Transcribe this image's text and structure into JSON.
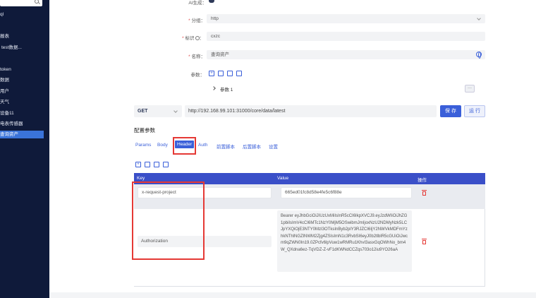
{
  "sidebar": {
    "items": [
      {
        "label": "ql"
      },
      {
        "label": "报表"
      },
      {
        "label": "test数据..."
      },
      {
        "label": "token"
      },
      {
        "label": "数据"
      },
      {
        "label": "用户"
      },
      {
        "label": "天气"
      },
      {
        "label": "设备11"
      },
      {
        "label": "电表传感器"
      },
      {
        "label": "查询资产"
      }
    ]
  },
  "form": {
    "ai_label": "AI生成：",
    "group_label": "分组：",
    "group_value": "http",
    "id_label": "标识",
    "id_value": "cxzc",
    "name_label": "名称：",
    "name_value": "查询资产",
    "params_label": "参数：",
    "param_row_label": "参数 1",
    "more_label": "···"
  },
  "request": {
    "method": "GET",
    "url": "http://192.168.99.101:31000/core/data/latest",
    "save_label": "保 存",
    "run_label": "运 行"
  },
  "config": {
    "title": "配置参数",
    "tabs": [
      {
        "label": "Params"
      },
      {
        "label": "Body"
      },
      {
        "label": "Header"
      },
      {
        "label": "Auth"
      },
      {
        "label": "前置脚本"
      },
      {
        "label": "后置脚本"
      },
      {
        "label": "设置"
      }
    ]
  },
  "table": {
    "headers": {
      "key": "Key",
      "value": "Value",
      "action": "操作"
    },
    "rows": [
      {
        "key": "x-request-project",
        "value": "665ed01fc8d58e4fe5c6f88e"
      },
      {
        "key": "Authorization",
        "value": "Bearer eyJhbGciOiJIUzUxMiIsInR5cCI6IkpXVCJ9.eyJzdWIiOiJhZG1pbiIsImV4cCI6MTc1NzY0MjM5OSwibmJmIjoxNzU2NDMyNzk5LCJpYXQiOjE3NTY0MzI3OTksInByb2plY3RJZCI6IjY2NWVkMDFmYzhkNThlNGZlNWM2Zjg4ZSIsImN1c3RvbSI6eyJ0b2tlblR5cGUiOiJwcm9qZWN0In19.0ZPcfv6lpVuw1wRMRu1KhvI3asxGqOWhNo_bm4W_QXdna6ez-TqVDZ-Z-vF1dKWNdCCZqs703o12iu9YO26aA"
      }
    ]
  },
  "colors": {
    "sidebar_bg": "#0f1a3a",
    "accent": "#3a5fd9",
    "table_header": "#3a4fc8",
    "highlight": "#e53935"
  }
}
